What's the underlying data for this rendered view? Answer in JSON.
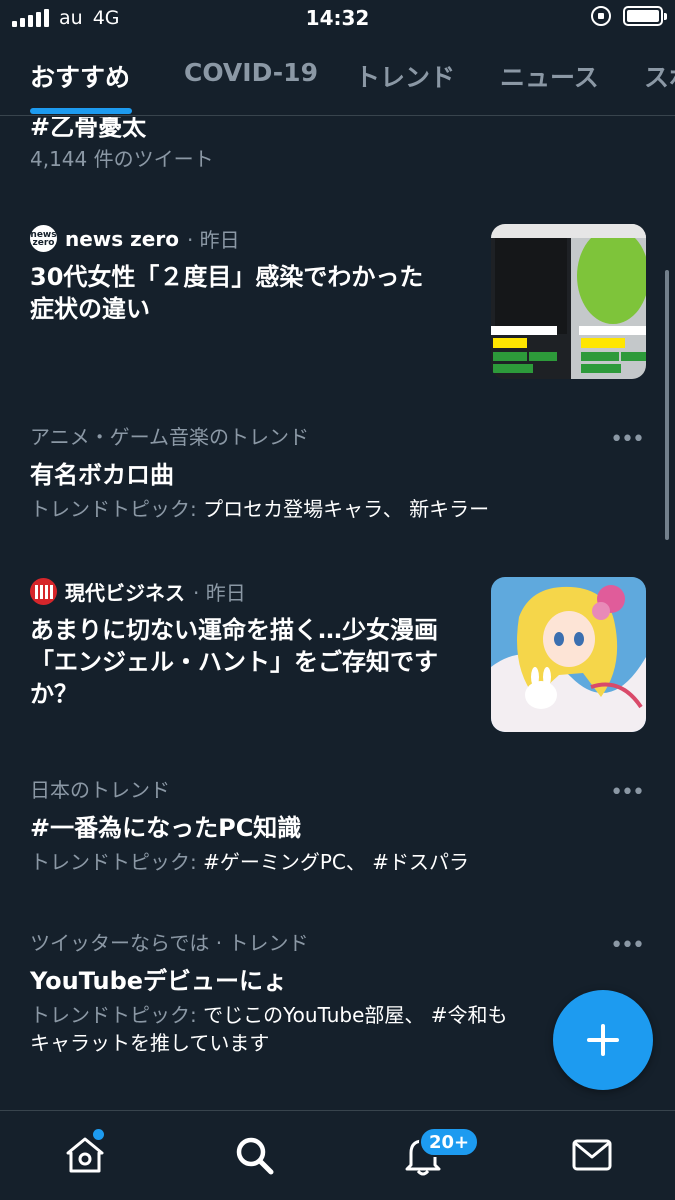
{
  "status_bar": {
    "carrier": "au",
    "network": "4G",
    "time": "14:32"
  },
  "tabs": [
    {
      "label": "おすすめ",
      "active": true
    },
    {
      "label": "COVID-19",
      "active": false
    },
    {
      "label": "トレンド",
      "active": false
    },
    {
      "label": "ニュース",
      "active": false
    },
    {
      "label": "スポ",
      "active": false
    }
  ],
  "feed": {
    "top_trend": {
      "title": "#乙骨憂太",
      "count": "4,144 件のツイート"
    },
    "news1": {
      "source": "news zero",
      "logo_text_1": "news",
      "logo_text_2": "zero",
      "time": "· 昨日",
      "headline_line1": "30代女性「２度目」感染でわかった",
      "headline_line2": "症状の違い"
    },
    "trend1": {
      "category": "アニメ・ゲーム音楽のトレンド",
      "title": "有名ボカロ曲",
      "topics_prefix": "トレンドトピック:",
      "topics": " プロセカ登場キャラ、 新キラー"
    },
    "news2": {
      "source": "現代ビジネス",
      "time": "· 昨日",
      "headline_line1": "あまりに切ない運命を描く…少女漫画",
      "headline_line2": "「エンジェル・ハント」をご存知です",
      "headline_line3": "か？"
    },
    "trend2": {
      "category": "日本のトレンド",
      "title": "#一番為になったPC知識",
      "topics_prefix": "トレンドトピック:",
      "topics": " #ゲーミングPC、 #ドスパラ"
    },
    "trend3": {
      "category": "ツイッターならでは · トレンド",
      "title": "YouTubeデビューにょ",
      "topics_prefix": "トレンドトピック:",
      "topics": " でじこのYouTube部屋、 #令和も",
      "topics_line2": "キャラットを推しています"
    },
    "more_label": "•••"
  },
  "bottom_nav": {
    "notification_badge": "20+"
  },
  "colors": {
    "background": "#15202b",
    "accent": "#1d9bf0",
    "muted": "#8b98a5",
    "divider": "#38444d"
  },
  "icons": [
    "home-icon",
    "search-icon",
    "bell-icon",
    "mail-icon",
    "plus-icon",
    "more-icon"
  ]
}
